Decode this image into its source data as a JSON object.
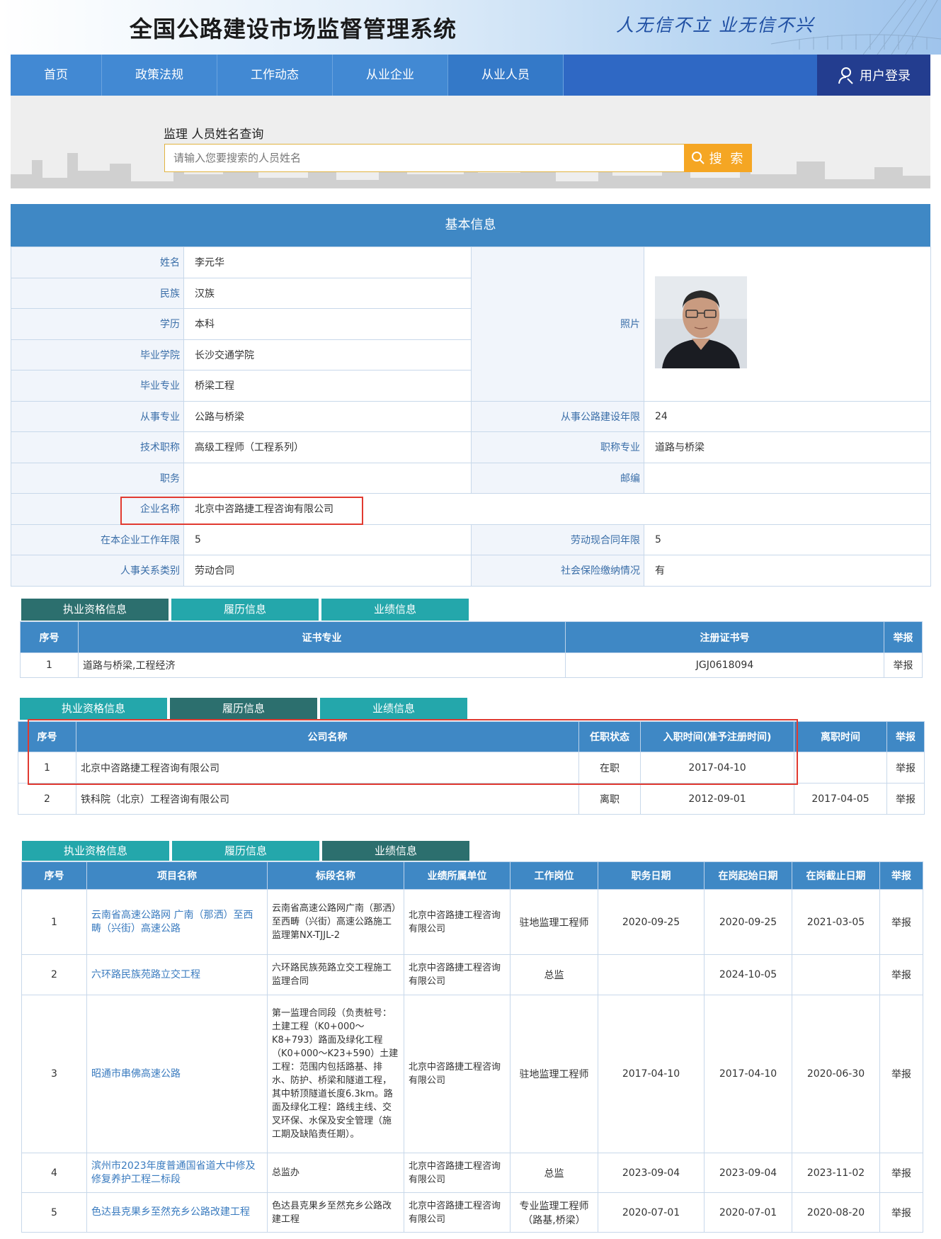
{
  "header": {
    "title": "全国公路建设市场监督管理系统",
    "slogan": "人无信不立 业无信不兴"
  },
  "nav": {
    "items": [
      "首页",
      "政策法规",
      "工作动态",
      "从业企业",
      "从业人员"
    ],
    "active_index": 4,
    "login_label": "用户登录"
  },
  "search": {
    "title": "监理 人员姓名查询",
    "placeholder": "请输入您要搜索的人员姓名",
    "button_label": "搜 索"
  },
  "basic": {
    "header": "基本信息",
    "name_label": "姓名",
    "name": "李元华",
    "ethnicity_label": "民族",
    "ethnicity": "汉族",
    "education_label": "学历",
    "education": "本科",
    "school_label": "毕业学院",
    "school": "长沙交通学院",
    "major_label": "毕业专业",
    "major": "桥梁工程",
    "photo_label": "照片",
    "field_label": "从事专业",
    "field": "公路与桥梁",
    "years_label": "从事公路建设年限",
    "years": "24",
    "title_label": "技术职称",
    "tech_title": "高级工程师（工程系列）",
    "title_major_label": "职称专业",
    "title_major": "道路与桥梁",
    "duty_label": "职务",
    "duty": "",
    "postcode_label": "邮编",
    "postcode": "",
    "company_label": "企业名称",
    "company": "北京中咨路捷工程咨询有限公司",
    "company_years_label": "在本企业工作年限",
    "company_years": "5",
    "contract_years_label": "劳动现合同年限",
    "contract_years": "5",
    "relation_label": "人事关系类别",
    "relation": "劳动合同",
    "insurance_label": "社会保险缴纳情况",
    "insurance": "有"
  },
  "tabs": [
    "执业资格信息",
    "履历信息",
    "业绩信息"
  ],
  "qualification": {
    "headers": [
      "序号",
      "证书专业",
      "注册证书号",
      "举报"
    ],
    "rows": [
      {
        "no": "1",
        "major": "道路与桥梁,工程经济",
        "cert": "JGJ0618094",
        "report": "举报"
      }
    ]
  },
  "history": {
    "headers": [
      "序号",
      "公司名称",
      "任职状态",
      "入职时间(准予注册时间)",
      "离职时间",
      "举报"
    ],
    "rows": [
      {
        "no": "1",
        "company": "北京中咨路捷工程咨询有限公司",
        "status": "在职",
        "start": "2017-04-10",
        "end": "",
        "report": "举报"
      },
      {
        "no": "2",
        "company": "铁科院（北京）工程咨询有限公司",
        "status": "离职",
        "start": "2012-09-01",
        "end": "2017-04-05",
        "report": "举报"
      }
    ]
  },
  "performance": {
    "headers": [
      "序号",
      "项目名称",
      "标段名称",
      "业绩所属单位",
      "工作岗位",
      "职务日期",
      "在岗起始日期",
      "在岗截止日期",
      "举报"
    ],
    "rows": [
      {
        "no": "1",
        "project": "云南省高速公路网 广南（那洒）至西畴（兴街）高速公路",
        "section": "云南省高速公路网广南（那洒）至西畴（兴街）高速公路施工监理第NX-TJJL-2",
        "unit": "北京中咨路捷工程咨询有限公司",
        "post": "驻地监理工程师",
        "duty_date": "2020-09-25",
        "start": "2020-09-25",
        "end": "2021-03-05",
        "report": "举报"
      },
      {
        "no": "2",
        "project": "六环路民族苑路立交工程",
        "section": "六环路民族苑路立交工程施工监理合同",
        "unit": "北京中咨路捷工程咨询有限公司",
        "post": "总监",
        "duty_date": "",
        "start": "2024-10-05",
        "end": "",
        "report": "举报"
      },
      {
        "no": "3",
        "project": "昭通市串佛高速公路",
        "section": "第一监理合同段（负责桩号：土建工程（K0+000～K8+793）路面及绿化工程（K0+000～K23+590）土建工程：范围内包括路基、排水、防护、桥梁和隧道工程，其中轿顶隧道长度6.3km。路面及绿化工程：路线主线、交叉环保、水保及安全管理（施工期及缺陷责任期）。",
        "unit": "北京中咨路捷工程咨询有限公司",
        "post": "驻地监理工程师",
        "duty_date": "2017-04-10",
        "start": "2017-04-10",
        "end": "2020-06-30",
        "report": "举报"
      },
      {
        "no": "4",
        "project": "滨州市2023年度普通国省道大中修及修复养护工程二标段",
        "section": "总监办",
        "unit": "北京中咨路捷工程咨询有限公司",
        "post": "总监",
        "duty_date": "2023-09-04",
        "start": "2023-09-04",
        "end": "2023-11-02",
        "report": "举报"
      },
      {
        "no": "5",
        "project": "色达县克果乡至然充乡公路改建工程",
        "section": "色达县克果乡至然充乡公路改建工程",
        "unit": "北京中咨路捷工程咨询有限公司",
        "post": "专业监理工程师（路基,桥梁）",
        "duty_date": "2020-07-01",
        "start": "2020-07-01",
        "end": "2020-08-20",
        "report": "举报"
      }
    ]
  },
  "colors": {
    "nav": "#4289d3",
    "header_blue": "#3f88c5",
    "tab": "#24a7ab",
    "tab_active": "#2c6f6e",
    "search_button": "#f5a623",
    "highlight": "#e13a30"
  }
}
